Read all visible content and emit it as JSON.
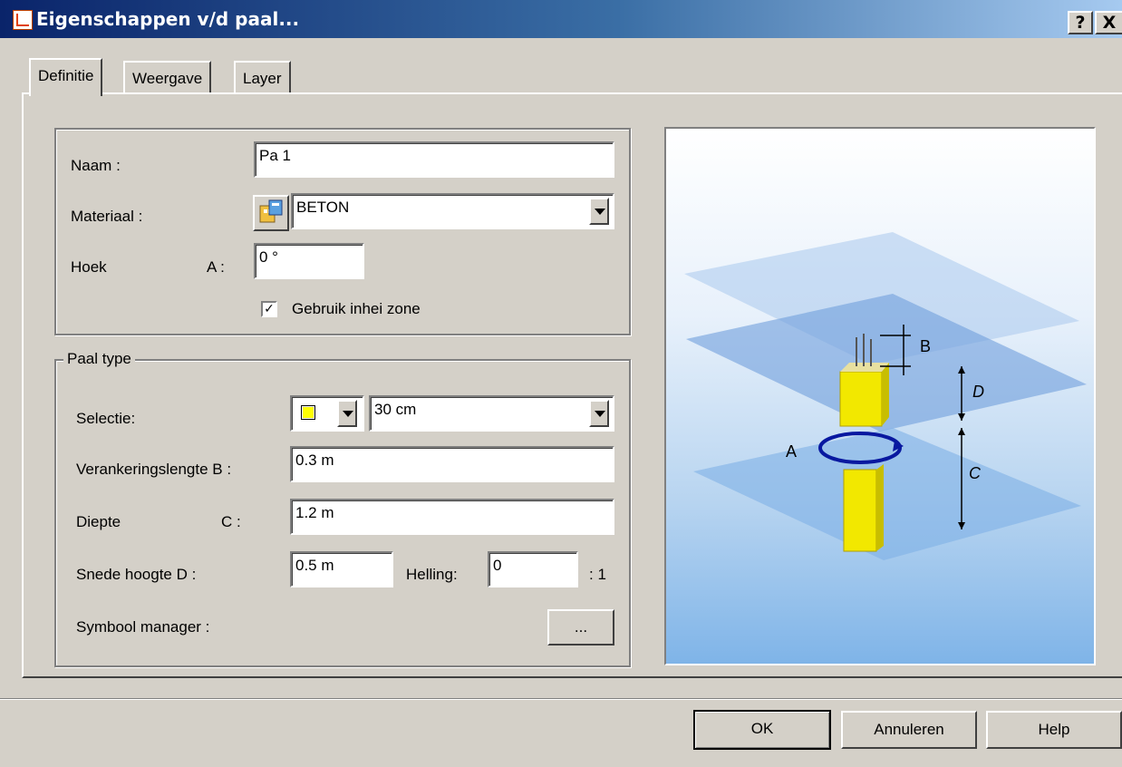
{
  "window": {
    "title": "Eigenschappen v/d paal...",
    "help_btn": "?",
    "close_btn": "X"
  },
  "tabs": [
    {
      "label": "Definitie",
      "active": true
    },
    {
      "label": "Weergave",
      "active": false
    },
    {
      "label": "Layer",
      "active": false
    }
  ],
  "general": {
    "naam_label": "Naam :",
    "naam_value": "Pa 1",
    "materiaal_label": "Materiaal :",
    "materiaal_value": "BETON",
    "hoek_label": "Hoek",
    "hoek_sub": "A :",
    "hoek_value": "0 °",
    "inhei_label": "Gebruik inhei zone",
    "inhei_checked": true,
    "check_mark": "✓"
  },
  "paal_type": {
    "legend": "Paal type",
    "selectie_label": "Selectie:",
    "selectie_value": "30 cm",
    "shape_color": "#ffff00",
    "veranker_label": "Verankeringslengte B :",
    "veranker_value": "0.3 m",
    "diepte_label": "Diepte",
    "diepte_sub": "C :",
    "diepte_value": "1.2 m",
    "snede_label": "Snede hoogte D :",
    "snede_value": "0.5 m",
    "helling_label": "Helling:",
    "helling_value": "0",
    "helling_suffix": ": 1",
    "symbool_label": "Symbool manager :",
    "symbool_btn": "..."
  },
  "preview_labels": {
    "a": "A",
    "b": "B",
    "c": "C",
    "d": "D"
  },
  "buttons": {
    "ok": "OK",
    "annuleren": "Annuleren",
    "help": "Help"
  }
}
